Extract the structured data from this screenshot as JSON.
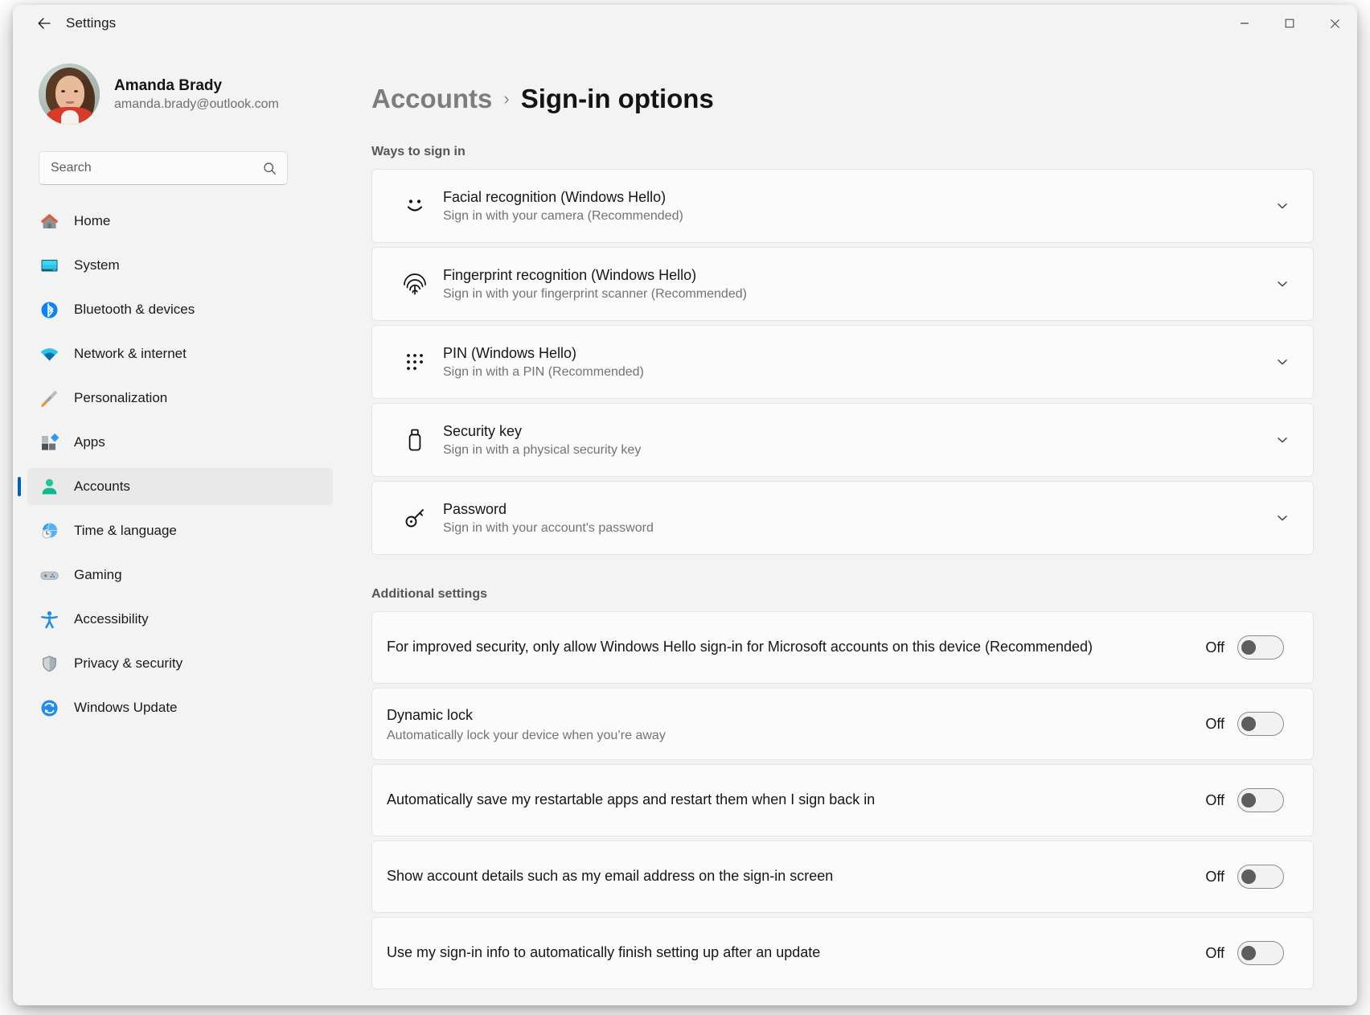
{
  "window": {
    "title": "Settings",
    "back_icon": "back-arrow-icon",
    "controls": {
      "minimize": "minimize-icon",
      "maximize": "maximize-icon",
      "close": "close-icon"
    }
  },
  "sidebar": {
    "profile": {
      "name": "Amanda Brady",
      "email": "amanda.brady@outlook.com",
      "avatar": "user-avatar-photo"
    },
    "search": {
      "placeholder": "Search",
      "value": "",
      "icon": "search-icon"
    },
    "items": [
      {
        "label": "Home",
        "icon": "home-icon",
        "selected": false
      },
      {
        "label": "System",
        "icon": "monitor-icon",
        "selected": false
      },
      {
        "label": "Bluetooth & devices",
        "icon": "bluetooth-icon",
        "selected": false
      },
      {
        "label": "Network & internet",
        "icon": "wifi-icon",
        "selected": false
      },
      {
        "label": "Personalization",
        "icon": "paintbrush-icon",
        "selected": false
      },
      {
        "label": "Apps",
        "icon": "apps-grid-icon",
        "selected": false
      },
      {
        "label": "Accounts",
        "icon": "person-icon",
        "selected": true
      },
      {
        "label": "Time & language",
        "icon": "clock-globe-icon",
        "selected": false
      },
      {
        "label": "Gaming",
        "icon": "gamepad-icon",
        "selected": false
      },
      {
        "label": "Accessibility",
        "icon": "accessibility-person-icon",
        "selected": false
      },
      {
        "label": "Privacy & security",
        "icon": "shield-icon",
        "selected": false
      },
      {
        "label": "Windows Update",
        "icon": "update-refresh-icon",
        "selected": false
      }
    ]
  },
  "main": {
    "breadcrumb": {
      "parent": "Accounts",
      "separator": "›",
      "current": "Sign-in options"
    },
    "ways_to_sign_in": {
      "heading": "Ways to sign in",
      "options": [
        {
          "title": "Facial recognition (Windows Hello)",
          "subtitle": "Sign in with your camera (Recommended)",
          "icon": "face-smile-icon",
          "chevron": "chevron-down-icon"
        },
        {
          "title": "Fingerprint recognition (Windows Hello)",
          "subtitle": "Sign in with your fingerprint scanner (Recommended)",
          "icon": "fingerprint-icon",
          "chevron": "chevron-down-icon"
        },
        {
          "title": "PIN (Windows Hello)",
          "subtitle": "Sign in with a PIN (Recommended)",
          "icon": "pin-keypad-icon",
          "chevron": "chevron-down-icon"
        },
        {
          "title": "Security key",
          "subtitle": "Sign in with a physical security key",
          "icon": "usb-security-key-icon",
          "chevron": "chevron-down-icon"
        },
        {
          "title": "Password",
          "subtitle": "Sign in with your account's password",
          "icon": "key-icon",
          "chevron": "chevron-down-icon"
        }
      ]
    },
    "additional_settings": {
      "heading": "Additional settings",
      "items": [
        {
          "title": "For improved security, only allow Windows Hello sign-in for Microsoft accounts on this device (Recommended)",
          "subtitle": "",
          "state": "Off",
          "on": false
        },
        {
          "title": "Dynamic lock",
          "subtitle": "Automatically lock your device when you’re away",
          "state": "Off",
          "on": false
        },
        {
          "title": "Automatically save my restartable apps and restart them when I sign back in",
          "subtitle": "",
          "state": "Off",
          "on": false
        },
        {
          "title": "Show account details such as my email address on the sign-in screen",
          "subtitle": "",
          "state": "Off",
          "on": false
        },
        {
          "title": "Use my sign-in info to automatically finish setting up after an update",
          "subtitle": "",
          "state": "Off",
          "on": false
        }
      ]
    }
  },
  "colors": {
    "accent": "#005fb8",
    "window_bg": "#f3f3f3",
    "card_bg": "#fbfbfb",
    "selected_nav_bg": "#e9e9e9"
  }
}
